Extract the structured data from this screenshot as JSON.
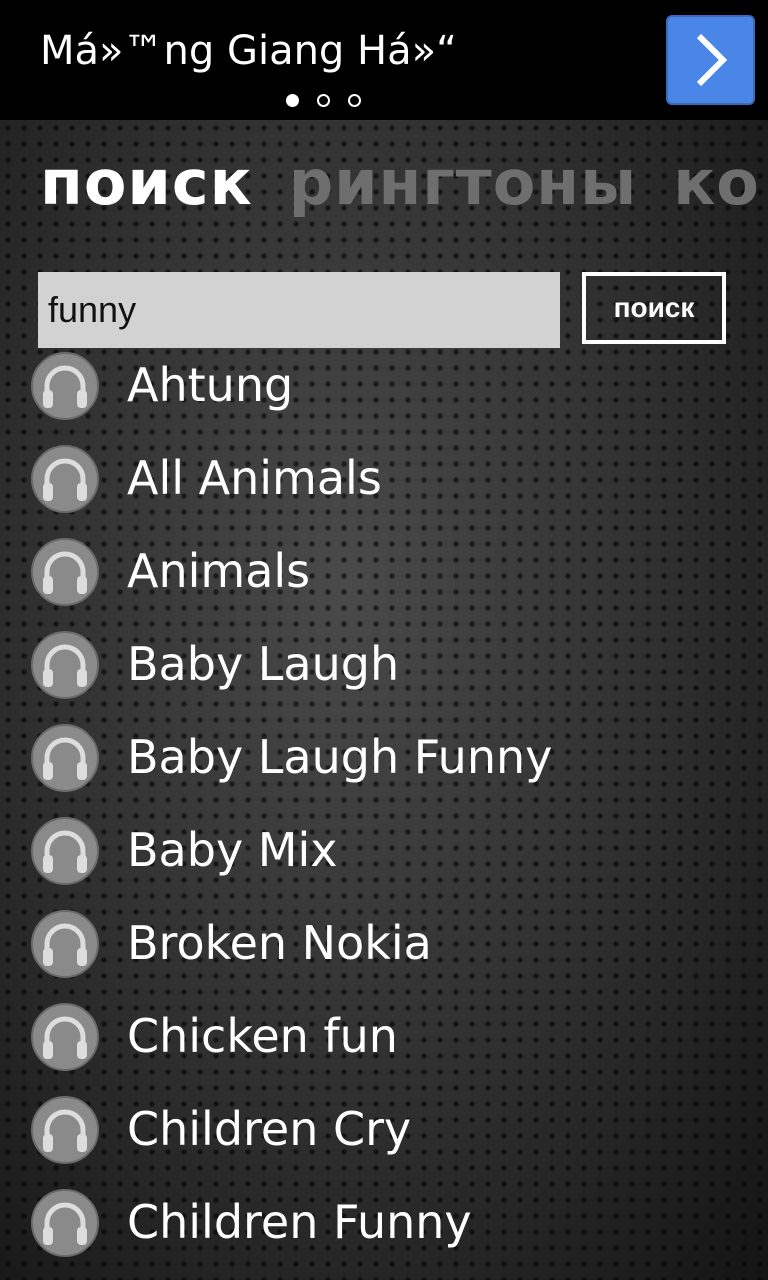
{
  "ad": {
    "title": "Má»™ng Giang Há»“",
    "next_icon": "chevron-right-icon",
    "accent": "#4a86e8",
    "pages": 3,
    "current_page": 1
  },
  "tabs": [
    {
      "label": "поиск",
      "active": true
    },
    {
      "label": "рингтоны",
      "active": false
    },
    {
      "label": "ко",
      "active": false
    }
  ],
  "search": {
    "value": "funny",
    "button_label": "поиск"
  },
  "results": [
    {
      "name": "Ahtung",
      "icon": "headphones-icon"
    },
    {
      "name": "All Animals",
      "icon": "headphones-icon"
    },
    {
      "name": "Animals",
      "icon": "headphones-icon"
    },
    {
      "name": "Baby Laugh",
      "icon": "headphones-icon"
    },
    {
      "name": "Baby Laugh Funny",
      "icon": "headphones-icon"
    },
    {
      "name": "Baby Mix",
      "icon": "headphones-icon"
    },
    {
      "name": "Broken Nokia",
      "icon": "headphones-icon"
    },
    {
      "name": "Chicken fun",
      "icon": "headphones-icon"
    },
    {
      "name": "Children Cry",
      "icon": "headphones-icon"
    },
    {
      "name": "Children Funny",
      "icon": "headphones-icon"
    }
  ]
}
